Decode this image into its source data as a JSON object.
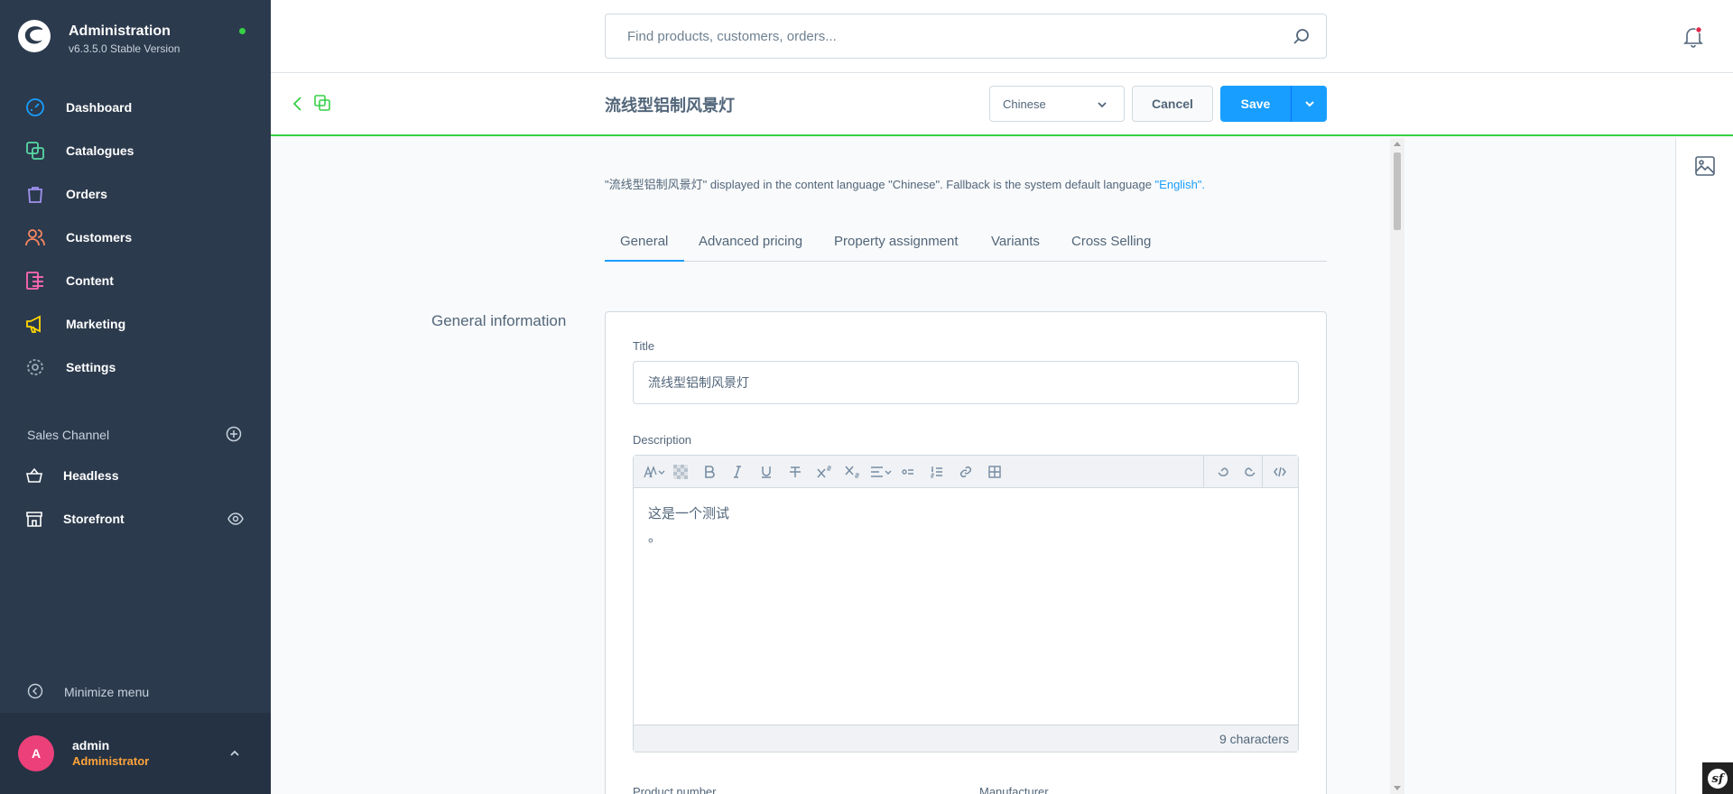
{
  "brand": {
    "title": "Administration",
    "version": "v6.3.5.0 Stable Version"
  },
  "nav": {
    "items": [
      {
        "label": "Dashboard",
        "icon": "dashboard-icon",
        "color": "#189eff"
      },
      {
        "label": "Catalogues",
        "icon": "catalogues-icon",
        "color": "#57d9a3"
      },
      {
        "label": "Orders",
        "icon": "orders-icon",
        "color": "#a092f0"
      },
      {
        "label": "Customers",
        "icon": "customers-icon",
        "color": "#f88962"
      },
      {
        "label": "Content",
        "icon": "content-icon",
        "color": "#ff68b4"
      },
      {
        "label": "Marketing",
        "icon": "marketing-icon",
        "color": "#ffd700"
      },
      {
        "label": "Settings",
        "icon": "settings-icon",
        "color": "#9aa8b5"
      }
    ]
  },
  "sales_channel": {
    "header": "Sales Channel",
    "items": [
      {
        "label": "Headless"
      },
      {
        "label": "Storefront"
      }
    ]
  },
  "minimize_label": "Minimize menu",
  "user": {
    "initial": "A",
    "name": "admin",
    "role": "Administrator"
  },
  "search": {
    "placeholder": "Find products, customers, orders..."
  },
  "smartbar": {
    "title": "流线型铝制风景灯",
    "language": "Chinese",
    "cancel_label": "Cancel",
    "save_label": "Save"
  },
  "lang_info": {
    "prefix": "\"流线型铝制风景灯\" displayed in the content language \"Chinese\". Fallback is the system default language ",
    "link": "\"English\"."
  },
  "tabs": [
    "General",
    "Advanced pricing",
    "Property assignment",
    "Variants",
    "Cross Selling"
  ],
  "section_title": "General information",
  "form": {
    "title_label": "Title",
    "title_value": "流线型铝制风景灯",
    "description_label": "Description",
    "description_line1": "这是一个测试",
    "description_line2": "。",
    "char_count": "9 characters",
    "product_number_label": "Product number",
    "manufacturer_label": "Manufacturer"
  },
  "colors": {
    "accent": "#189eff",
    "sidebar": "#2c3a4d",
    "online": "#37d046",
    "role": "#ffa33a",
    "avatar": "#ec407a"
  }
}
